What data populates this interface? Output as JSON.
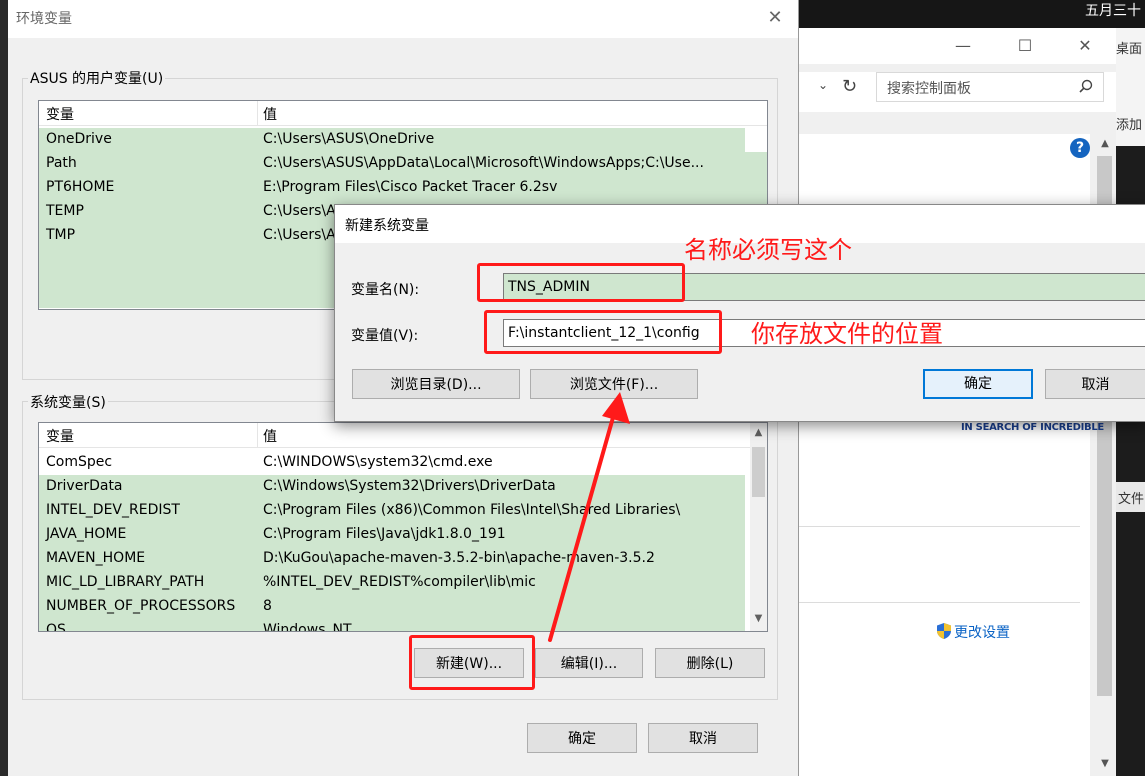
{
  "desktop": {
    "clock_text": "五月三十"
  },
  "control_panel": {
    "search_placeholder": "搜索控制面板",
    "side_label_1": "桌面",
    "side_label_2": "添加",
    "side_label_3": "文件",
    "brand_tagline": "IN SEARCH OF INCREDIBLE",
    "change_settings": "更改设置",
    "help_icon": "?"
  },
  "env_dialog": {
    "title": "环境变量",
    "user_group_label": "ASUS 的用户变量(U)",
    "user_columns": [
      "变量",
      "值"
    ],
    "user_vars": [
      {
        "name": "OneDrive",
        "value": "C:\\Users\\ASUS\\OneDrive"
      },
      {
        "name": "Path",
        "value": "C:\\Users\\ASUS\\AppData\\Local\\Microsoft\\WindowsApps;C:\\Use..."
      },
      {
        "name": "PT6HOME",
        "value": "E:\\Program Files\\Cisco Packet Tracer 6.2sv"
      },
      {
        "name": "TEMP",
        "value": "C:\\Users\\A"
      },
      {
        "name": "TMP",
        "value": "C:\\Users\\A"
      }
    ],
    "sys_group_label": "系统变量(S)",
    "sys_columns": [
      "变量",
      "值"
    ],
    "sys_vars": [
      {
        "name": "ComSpec",
        "value": "C:\\WINDOWS\\system32\\cmd.exe"
      },
      {
        "name": "DriverData",
        "value": "C:\\Windows\\System32\\Drivers\\DriverData"
      },
      {
        "name": "INTEL_DEV_REDIST",
        "value": "C:\\Program Files (x86)\\Common Files\\Intel\\Shared Libraries\\"
      },
      {
        "name": "JAVA_HOME",
        "value": "C:\\Program Files\\Java\\jdk1.8.0_191"
      },
      {
        "name": "MAVEN_HOME",
        "value": "D:\\KuGou\\apache-maven-3.5.2-bin\\apache-maven-3.5.2"
      },
      {
        "name": "MIC_LD_LIBRARY_PATH",
        "value": "%INTEL_DEV_REDIST%compiler\\lib\\mic"
      },
      {
        "name": "NUMBER_OF_PROCESSORS",
        "value": "8"
      },
      {
        "name": "OS",
        "value": "Windows_NT"
      }
    ],
    "buttons": {
      "new": "新建(W)...",
      "edit": "编辑(I)...",
      "delete": "删除(L)",
      "ok": "确定",
      "cancel": "取消"
    }
  },
  "new_var_dialog": {
    "title": "新建系统变量",
    "name_label": "变量名(N):",
    "value_label": "变量值(V):",
    "name_value": "TNS_ADMIN",
    "value_value": "F:\\instantclient_12_1\\config",
    "buttons": {
      "browse_dir": "浏览目录(D)...",
      "browse_file": "浏览文件(F)...",
      "ok": "确定",
      "cancel": "取消"
    }
  },
  "annotations": {
    "name_note": "名称必须写这个",
    "value_note": "你存放文件的位置",
    "color": "#ff1a1a"
  },
  "colors": {
    "selection_green": "#cfe6cf",
    "accent_blue": "#0078d7"
  }
}
